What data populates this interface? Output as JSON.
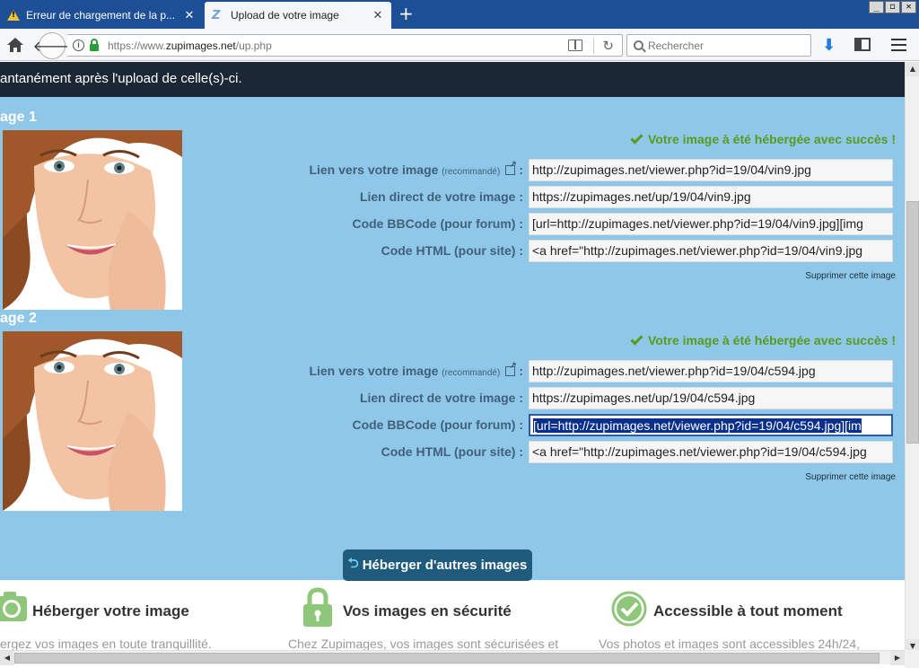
{
  "browser": {
    "tabs": [
      {
        "title": "Erreur de chargement de la p...",
        "icon": "warning-icon",
        "active": false
      },
      {
        "title": "Upload de votre image",
        "icon": "zupimages-icon",
        "active": true
      }
    ],
    "new_tab_label": "+",
    "url_prefix": "https://www.",
    "url_domain": "zupimages.net",
    "url_path": "/up.php",
    "search_placeholder": "Rechercher",
    "window_buttons": [
      "_",
      "◻",
      "✕"
    ]
  },
  "page": {
    "banner_text": "antanément après l'upload de celle(s)-ci.",
    "images": [
      {
        "heading": "age 1",
        "success": "Votre image à été hébergée avec succès !",
        "rows": [
          {
            "label": "Lien vers votre image",
            "note": "(recommandé)",
            "value": "http://zupimages.net/viewer.php?id=19/04/vin9.jpg"
          },
          {
            "label": "Lien direct de votre image :",
            "value": "https://zupimages.net/up/19/04/vin9.jpg"
          },
          {
            "label": "Code BBCode (pour forum) :",
            "value": "[url=http://zupimages.net/viewer.php?id=19/04/vin9.jpg][img"
          },
          {
            "label": "Code HTML (pour site) :",
            "value": "<a href=\"http://zupimages.net/viewer.php?id=19/04/vin9.jpg"
          }
        ],
        "delete": "Supprimer cette image"
      },
      {
        "heading": "age 2",
        "success": "Votre image à été hébergée avec succès !",
        "rows": [
          {
            "label": "Lien vers votre image",
            "note": "(recommandé)",
            "value": "http://zupimages.net/viewer.php?id=19/04/c594.jpg"
          },
          {
            "label": "Lien direct de votre image :",
            "value": "https://zupimages.net/up/19/04/c594.jpg"
          },
          {
            "label": "Code BBCode (pour forum) :",
            "value": "[url=http://zupimages.net/viewer.php?id=19/04/c594.jpg][im"
          },
          {
            "label": "Code HTML (pour site) :",
            "value": "<a href=\"http://zupimages.net/viewer.php?id=19/04/c594.jpg"
          }
        ],
        "delete": "Supprimer cette image"
      }
    ],
    "host_more_button": "Héberger d'autres images",
    "features": [
      {
        "title": "Héberger votre image",
        "text": "ergez vos images en toute tranquillité.",
        "icon": "camera-icon"
      },
      {
        "title": "Vos images en sécurité",
        "text": "Chez Zupimages, vos images sont sécurisées et",
        "icon": "padlock-icon"
      },
      {
        "title": "Accessible à tout moment",
        "text": "Vos photos et images sont accessibles 24h/24,",
        "icon": "check-circle-icon"
      }
    ]
  },
  "colors": {
    "tab_strip": "#1d4f97",
    "panel_blue": "#8ec7e8",
    "dark_banner": "#1c2736",
    "success_green": "#5a9a1f",
    "label_blue": "#41607a",
    "button_bg": "#1e5b7c",
    "feature_icon_green": "#8fc77a"
  }
}
